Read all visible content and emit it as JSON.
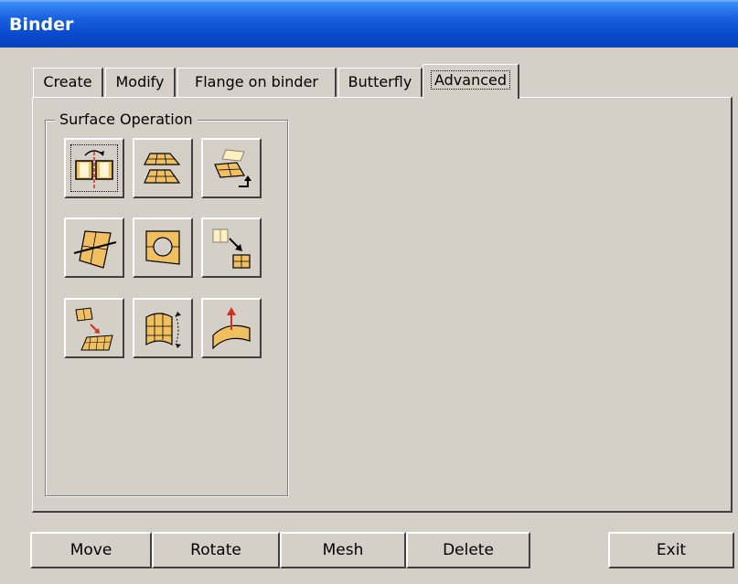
{
  "window": {
    "title": "Binder"
  },
  "tabs": [
    {
      "label": "Create"
    },
    {
      "label": "Modify"
    },
    {
      "label": "Flange on binder"
    },
    {
      "label": "Butterfly"
    },
    {
      "label": "Advanced",
      "selected": true
    }
  ],
  "group": {
    "label": "Surface Operation",
    "tools": [
      {
        "icon": "split-surface-icon"
      },
      {
        "icon": "offset-surfaces-icon"
      },
      {
        "icon": "copy-surface-icon"
      },
      {
        "icon": "trim-surface-line-icon"
      },
      {
        "icon": "fill-hole-icon"
      },
      {
        "icon": "surface-to-mesh-icon"
      },
      {
        "icon": "map-surface-mesh-icon"
      },
      {
        "icon": "extend-surface-icon"
      },
      {
        "icon": "normal-direction-icon"
      }
    ]
  },
  "buttons": {
    "move": "Move",
    "rotate": "Rotate",
    "mesh": "Mesh",
    "delete": "Delete",
    "exit": "Exit"
  },
  "colors": {
    "titlebar": "#0a4ad0",
    "face": "#d4d0c8",
    "surface_fill": "#f0c060",
    "accent_red": "#d03020"
  }
}
